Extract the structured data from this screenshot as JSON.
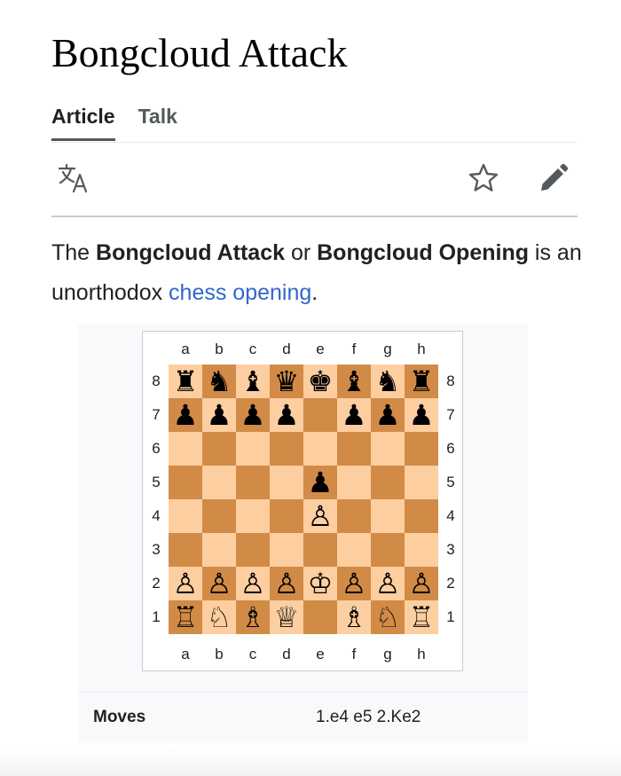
{
  "page": {
    "title": "Bongcloud Attack",
    "tabs": [
      {
        "label": "Article",
        "active": true
      },
      {
        "label": "Talk",
        "active": false
      }
    ],
    "toolbar": {
      "language_icon": "translate-icon",
      "watch_icon": "star-icon",
      "edit_icon": "pencil-icon"
    },
    "intro": {
      "text_1": "The ",
      "bold_1": "Bongcloud Attack",
      "text_2": " or ",
      "bold_2": "Bongcloud Opening",
      "text_3": " is an unorthodox ",
      "link": "chess opening",
      "text_4": "."
    }
  },
  "infobox": {
    "board": {
      "files": [
        "a",
        "b",
        "c",
        "d",
        "e",
        "f",
        "g",
        "h"
      ],
      "ranks": [
        "8",
        "7",
        "6",
        "5",
        "4",
        "3",
        "2",
        "1"
      ],
      "light_color": "#fdcea0",
      "dark_color": "#d18b47",
      "position": [
        [
          "br",
          "bn",
          "bb",
          "bq",
          "bk",
          "bb",
          "bn",
          "br"
        ],
        [
          "bp",
          "bp",
          "bp",
          "bp",
          "",
          "bp",
          "bp",
          "bp"
        ],
        [
          "",
          "",
          "",
          "",
          "",
          "",
          "",
          ""
        ],
        [
          "",
          "",
          "",
          "",
          "bp",
          "",
          "",
          ""
        ],
        [
          "",
          "",
          "",
          "",
          "wp",
          "",
          "",
          ""
        ],
        [
          "",
          "",
          "",
          "",
          "",
          "",
          "",
          ""
        ],
        [
          "wp",
          "wp",
          "wp",
          "wp",
          "wk",
          "wp",
          "wp",
          "wp"
        ],
        [
          "wr",
          "wn",
          "wb",
          "wq",
          "",
          "wb",
          "wn",
          "wr"
        ]
      ]
    },
    "moves_label": "Moves",
    "moves_value": "1.e4 e5 2.Ke2"
  },
  "colors": {
    "link": "#3366cc",
    "text": "#202122"
  }
}
